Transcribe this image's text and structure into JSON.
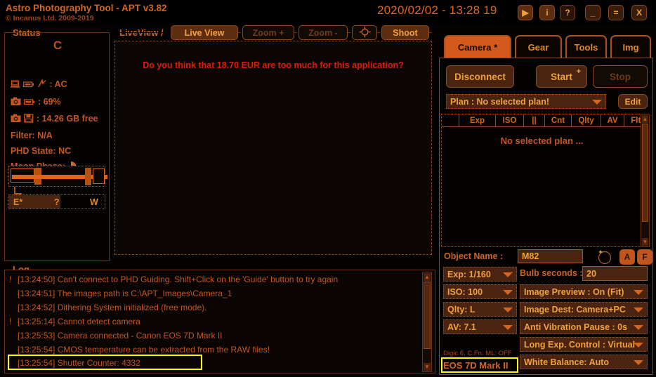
{
  "titlebar": {
    "app_title": "Astro Photography Tool  -   APT v3.82",
    "copyright": "© Incanus Ltd. 2009-2019",
    "clock": "2020/02/02 - 13:28 19",
    "buttons": [
      {
        "name": "play-button",
        "glyph": "▶"
      },
      {
        "name": "info-button",
        "glyph": "i"
      },
      {
        "name": "help-button",
        "glyph": "?"
      },
      {
        "name": "minimize-button",
        "glyph": "_"
      },
      {
        "name": "restore-button",
        "glyph": "="
      },
      {
        "name": "close-button",
        "glyph": "X"
      }
    ]
  },
  "status": {
    "group_label": "Status",
    "connection_letter": "C",
    "power": ": AC",
    "battery": ": 69%",
    "storage": ": 14.26 GB free",
    "filter": "Filter: N/A",
    "phd_state": "PHD State: NC",
    "moon_phase_label": "Moon Phase:",
    "compass": {
      "east": "E*",
      "unknown": "?",
      "west": "W"
    }
  },
  "liveview": {
    "group_label": "LiveView /",
    "buttons": [
      {
        "label": "Live View",
        "state": "on"
      },
      {
        "label": "Zoom +",
        "state": "off"
      },
      {
        "label": "Zoom -",
        "state": "off"
      },
      {
        "label": "reticle-icon",
        "state": "icon"
      },
      {
        "label": "Shoot",
        "state": "on"
      }
    ],
    "message": "Do you think that 18.70 EUR are too much for this application?"
  },
  "log": {
    "group_label": "Log",
    "entries": [
      {
        "mark": "!",
        "text": "[13:24:50] Can't connect to PHD Guiding. Shift+Click on the 'Guide' button to try again",
        "highlight": false
      },
      {
        "mark": "",
        "text": "[13:24:51] The images path is C:\\APT_Images\\Camera_1",
        "highlight": false
      },
      {
        "mark": "",
        "text": "[13:24:52] Dithering System initialized (free mode).",
        "highlight": false
      },
      {
        "mark": "!",
        "text": "[13:25:14] Cannot detect camera",
        "highlight": false
      },
      {
        "mark": "",
        "text": "[13:25:53] Camera connected - Canon EOS 7D Mark II",
        "highlight": false
      },
      {
        "mark": "",
        "text": "[13:25:54] CMOS temperature can be extracted from the RAW files!",
        "highlight": false
      },
      {
        "mark": "",
        "text": "[13:25:54] Shutter Counter: 4332",
        "highlight": true
      }
    ]
  },
  "right_panel": {
    "tabs": [
      {
        "label": "Camera *",
        "active": true
      },
      {
        "label": "Gear",
        "active": false
      },
      {
        "label": "Tools",
        "active": false
      },
      {
        "label": "Img",
        "active": false
      }
    ],
    "connect_button": "Disconnect",
    "start_button": "Start",
    "start_sup": "+",
    "stop_button": "Stop",
    "plan_combo": "Plan : No selected plan!",
    "edit_button": "Edit",
    "plan_columns": [
      "",
      "Exp",
      "ISO",
      "||",
      "Cnt",
      "Qlty",
      "AV",
      "Fltr"
    ],
    "plan_empty": "No selected plan ...",
    "object_name_label": "Object Name :",
    "object_name_value": "M82",
    "object_buttons": [
      "A",
      "F"
    ],
    "left_combos": [
      {
        "label": "Exp: 1/160"
      },
      {
        "label": "ISO: 100"
      },
      {
        "label": "Qlty: L"
      },
      {
        "label": "AV: 7.1"
      }
    ],
    "bulb_label": "Bulb seconds :",
    "bulb_value": "20",
    "right_combos": [
      {
        "label": "Image Preview : On (Fit)"
      },
      {
        "label": "Image Dest: Camera+PC"
      },
      {
        "label": "Anti Vibration Pause : 0s"
      },
      {
        "label": "Long Exp. Control : Virtual"
      },
      {
        "label": "White Balance: Auto"
      }
    ],
    "digic_info": "Digic 6, C.Fn. ML: OFF",
    "camera_model": "EOS 7D Mark II"
  },
  "colors": {
    "accent": "#d4651f",
    "text": "#c4561e",
    "bright": "#f0a13c",
    "alert": "#e01b0c",
    "highlight": "#ffff00",
    "background": "#050302"
  }
}
